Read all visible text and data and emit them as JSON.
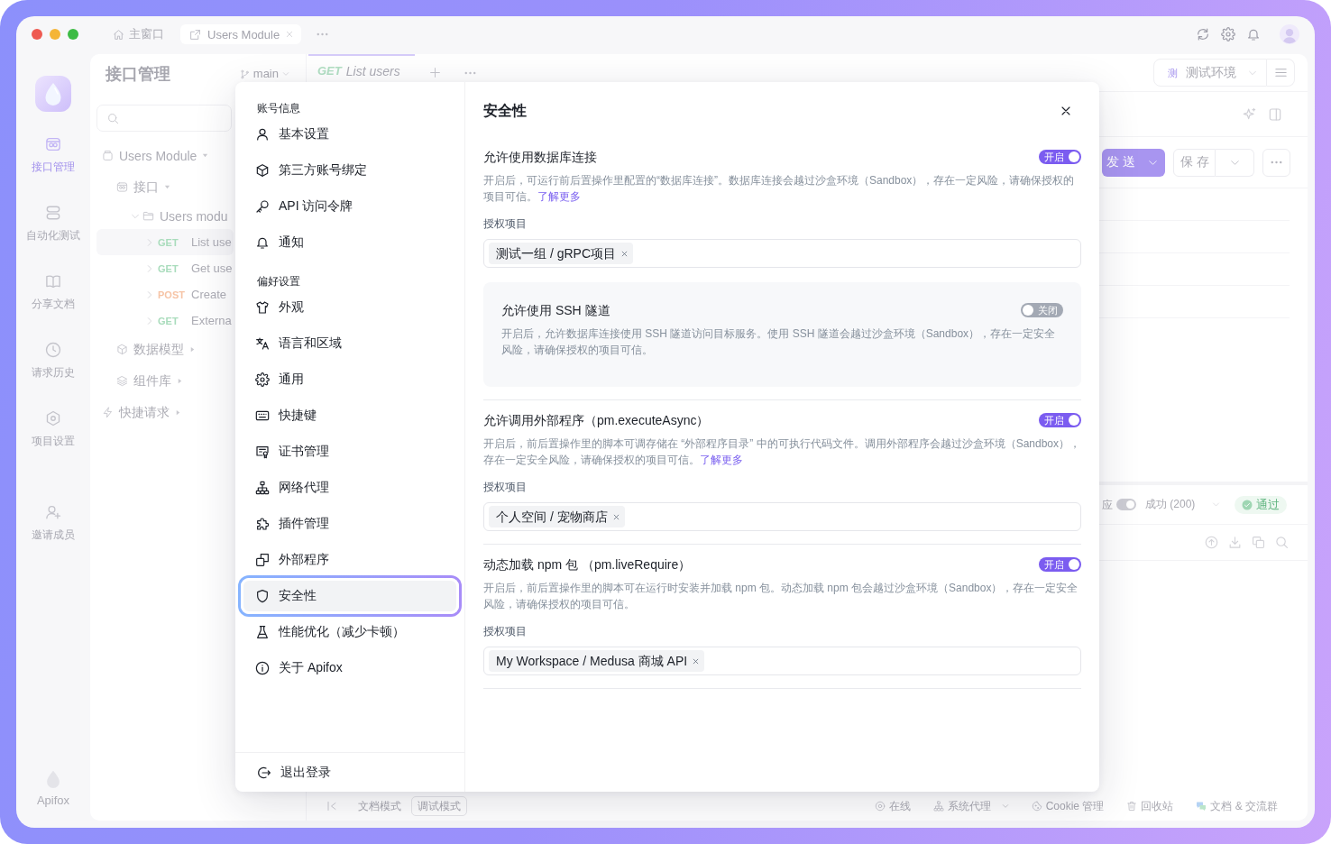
{
  "title_bar": {
    "tabs": [
      {
        "label": "主窗口",
        "selected": false
      },
      {
        "label": "Users Module",
        "selected": true
      }
    ]
  },
  "rail": {
    "items": [
      {
        "label": "接口管理",
        "selected": true
      },
      {
        "label": "自动化测试",
        "selected": false
      },
      {
        "label": "分享文档",
        "selected": false
      },
      {
        "label": "请求历史",
        "selected": false
      },
      {
        "label": "项目设置",
        "selected": false
      }
    ],
    "invite": "邀请成员",
    "brand": "Apifox"
  },
  "tree_panel": {
    "title": "接口管理",
    "branch": "main",
    "tree": [
      {
        "kind": "group",
        "label": "Users Module",
        "expanded": true,
        "children": [
          {
            "kind": "group",
            "label": "接口",
            "expanded": true,
            "children": [
              {
                "kind": "folder",
                "label": "Users modu",
                "expanded": true,
                "children": [
                  {
                    "kind": "request",
                    "method": "GET",
                    "color": "#a9dcbc",
                    "label": "List use",
                    "expanded": false,
                    "selected": true
                  },
                  {
                    "kind": "request",
                    "method": "GET",
                    "color": "#a9dcbc",
                    "label": "Get use",
                    "expanded": false,
                    "selected": false
                  },
                  {
                    "kind": "request",
                    "method": "POST",
                    "color": "#f6c4a6",
                    "label": "Create",
                    "expanded": false,
                    "selected": false
                  },
                  {
                    "kind": "request",
                    "method": "GET",
                    "color": "#a9dcbc",
                    "label": "Externa",
                    "expanded": false,
                    "selected": false
                  }
                ]
              }
            ]
          },
          {
            "kind": "group",
            "label": "数据模型",
            "expanded": false
          },
          {
            "kind": "group",
            "label": "组件库",
            "expanded": false
          }
        ]
      },
      {
        "kind": "group",
        "label": "快捷请求",
        "expanded": false
      }
    ]
  },
  "editor": {
    "tabs": [
      {
        "method": "GET",
        "color": "#b3e0c4",
        "label": "List users",
        "selected": true
      }
    ],
    "environment": {
      "badge": "测",
      "label": "测试环境"
    },
    "send": "发送",
    "save": "保存",
    "response": {
      "label": "应",
      "on": true,
      "status": "成功 (200)",
      "result": "通过"
    }
  },
  "status_bar": {
    "modes": [
      {
        "label": "文档模式",
        "selected": false
      },
      {
        "label": "调试模式",
        "selected": true
      }
    ],
    "items": [
      {
        "label": "在线",
        "dropdown": false
      },
      {
        "label": "系统代理",
        "dropdown": true
      },
      {
        "label": "Cookie 管理",
        "dropdown": false
      },
      {
        "label": "回收站",
        "dropdown": false
      },
      {
        "label": "文档 & 交流群",
        "dropdown": false
      }
    ]
  },
  "settings_dialog": {
    "nav": [
      {
        "heading": "账号信息",
        "items": [
          {
            "label": "基本设置",
            "selected": false
          },
          {
            "label": "第三方账号绑定",
            "selected": false
          },
          {
            "label": "API 访问令牌",
            "selected": false
          },
          {
            "label": "通知",
            "selected": false
          }
        ]
      },
      {
        "heading": "偏好设置",
        "items": [
          {
            "label": "外观",
            "selected": false
          },
          {
            "label": "语言和区域",
            "selected": false
          },
          {
            "label": "通用",
            "selected": false
          },
          {
            "label": "快捷键",
            "selected": false
          },
          {
            "label": "证书管理",
            "selected": false
          },
          {
            "label": "网络代理",
            "selected": false
          },
          {
            "label": "插件管理",
            "selected": false
          },
          {
            "label": "外部程序",
            "selected": false
          },
          {
            "label": "安全性",
            "selected": true
          },
          {
            "label": "性能优化（减少卡顿）",
            "selected": false
          },
          {
            "label": "关于 Apifox",
            "selected": false
          }
        ]
      }
    ],
    "logout": "退出登录",
    "title": "安全性",
    "settings": [
      {
        "title": "允许使用数据库连接",
        "on": true,
        "switch_label": "开启",
        "description": "开启后，可运行前后置操作里配置的“数据库连接”。数据库连接会越过沙盒环境（Sandbox），存在一定风险，请确保授权的项目可信。",
        "link": "了解更多",
        "scope_label": "授权项目",
        "scopes": [
          "测试一组 / gRPC项目"
        ],
        "children": [
          {
            "title": "允许使用 SSH 隧道",
            "on": false,
            "switch_label": "关闭",
            "description": "开启后，允许数据库连接使用 SSH 隧道访问目标服务。使用 SSH 隧道会越过沙盒环境（Sandbox），存在一定安全风险，请确保授权的项目可信。"
          }
        ]
      },
      {
        "title": "允许调用外部程序（pm.executeAsync）",
        "on": true,
        "switch_label": "开启",
        "description": "开启后，前后置操作里的脚本可调存储在 “外部程序目录” 中的可执行代码文件。调用外部程序会越过沙盒环境（Sandbox），存在一定安全风险，请确保授权的项目可信。",
        "link": "了解更多",
        "scope_label": "授权项目",
        "scopes": [
          "个人空间 / 宠物商店"
        ]
      },
      {
        "title": "动态加载 npm 包 （pm.liveRequire）",
        "on": true,
        "switch_label": "开启",
        "description": "开启后，前后置操作里的脚本可在运行时安装并加载 npm 包。动态加载 npm 包会越过沙盒环境（Sandbox），存在一定安全风险，请确保授权的项目可信。",
        "scope_label": "授权项目",
        "scopes": [
          "My Workspace / Medusa 商城 API"
        ]
      }
    ]
  }
}
